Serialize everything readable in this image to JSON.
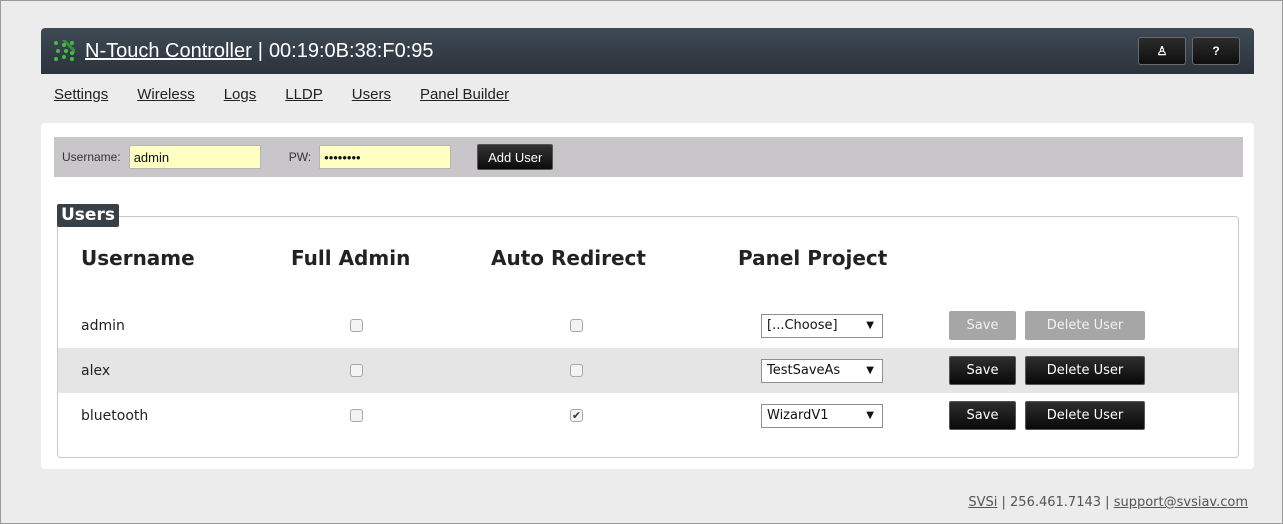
{
  "header": {
    "title_link": "N-Touch Controller",
    "separator": "|",
    "mac": "00:19:0B:38:F0:95",
    "user_button": "♙",
    "help_button": "?"
  },
  "nav": [
    "Settings",
    "Wireless",
    "Logs",
    "LLDP",
    "Users",
    "Panel Builder"
  ],
  "add_user": {
    "username_label": "Username:",
    "username_value": "admin",
    "pw_label": "PW:",
    "pw_value": "••••••••",
    "add_button": "Add User"
  },
  "users": {
    "legend": "Users",
    "columns": [
      "Username",
      "Full Admin",
      "Auto Redirect",
      "Panel Project"
    ],
    "rows": [
      {
        "username": "admin",
        "full_admin": false,
        "auto_redirect": false,
        "project": "[...Choose]",
        "save": "Save",
        "delete": "Delete User",
        "enabled": false
      },
      {
        "username": "alex",
        "full_admin": false,
        "auto_redirect": false,
        "project": "TestSaveAs",
        "save": "Save",
        "delete": "Delete User",
        "enabled": true
      },
      {
        "username": "bluetooth",
        "full_admin": false,
        "auto_redirect": true,
        "project": "WizardV1",
        "save": "Save",
        "delete": "Delete User",
        "enabled": true
      }
    ]
  },
  "footer": {
    "brand": "SVSi",
    "sep1": "|",
    "phone": "256.461.7143",
    "sep2": "|",
    "email": "support@svsiav.com"
  },
  "colors": {
    "header_bg": "#2b333c",
    "input_bg": "#ffffc2",
    "logo_green": "#3fbf3f"
  }
}
